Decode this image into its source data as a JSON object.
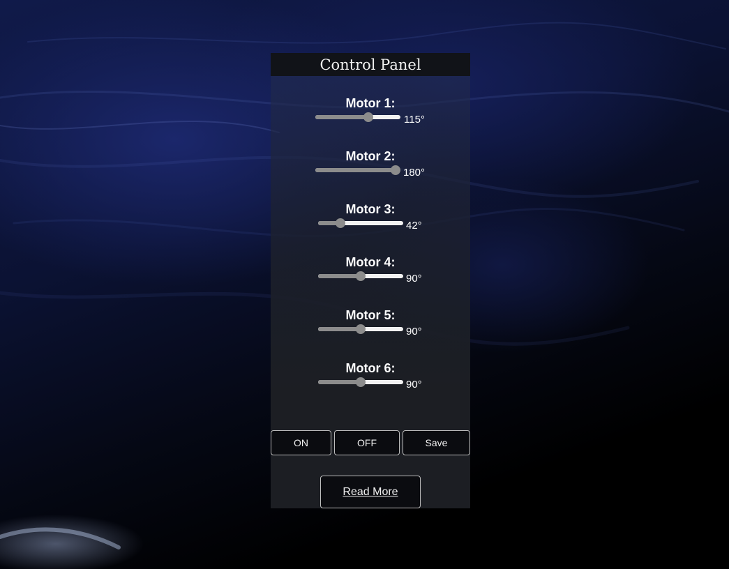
{
  "panel": {
    "title": "Control Panel"
  },
  "motors": [
    {
      "label": "Motor 1:",
      "value": 115,
      "max": 180,
      "value_text": "115°"
    },
    {
      "label": "Motor 2:",
      "value": 180,
      "max": 180,
      "value_text": "180°"
    },
    {
      "label": "Motor 3:",
      "value": 42,
      "max": 180,
      "value_text": "42°"
    },
    {
      "label": "Motor 4:",
      "value": 90,
      "max": 180,
      "value_text": "90°"
    },
    {
      "label": "Motor 5:",
      "value": 90,
      "max": 180,
      "value_text": "90°"
    },
    {
      "label": "Motor 6:",
      "value": 90,
      "max": 180,
      "value_text": "90°"
    }
  ],
  "buttons": {
    "on_label": "ON",
    "off_label": "OFF",
    "save_label": "Save",
    "read_more_label": "Read More"
  },
  "colors": {
    "panel_header": "#111318",
    "slider_fill": "#8c8c8c",
    "slider_track": "#f2f2f2",
    "button_bg": "#0b0c10"
  }
}
